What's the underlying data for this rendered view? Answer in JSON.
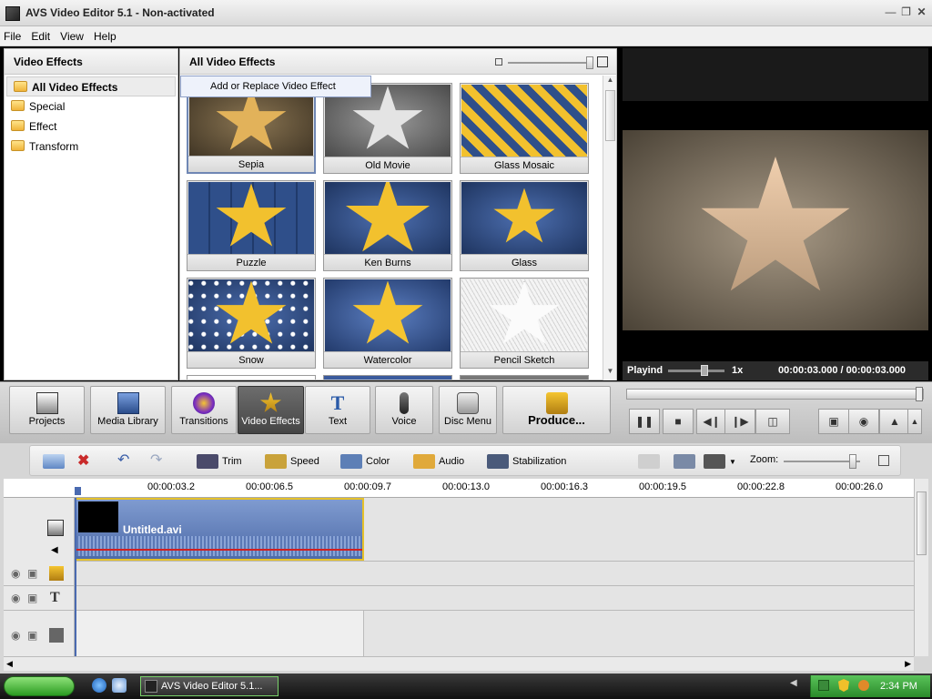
{
  "window": {
    "title": "AVS Video Editor 5.1 - Non-activated"
  },
  "menu": [
    "File",
    "Edit",
    "View",
    "Help"
  ],
  "left_panel": {
    "header": "Video Effects",
    "categories": [
      "All Video Effects",
      "Special",
      "Effect",
      "Transform"
    ]
  },
  "center_panel": {
    "header": "All Video Effects",
    "tooltip": "Add or Replace Video Effect",
    "effects": [
      "Sepia",
      "Old Movie",
      "Glass Mosaic",
      "Puzzle",
      "Ken Burns",
      "Glass",
      "Snow",
      "Watercolor",
      "Pencil Sketch"
    ]
  },
  "preview": {
    "state": "Playind",
    "speed": "1x",
    "time": "00:00:03.000 / 00:00:03.000"
  },
  "main_toolbar": {
    "projects": "Projects",
    "media_library": "Media Library",
    "transitions": "Transitions",
    "video_effects": "Video Effects",
    "text": "Text",
    "voice": "Voice",
    "disc_menu": "Disc Menu",
    "produce": "Produce..."
  },
  "timeline_toolbar": {
    "trim": "Trim",
    "speed": "Speed",
    "color": "Color",
    "audio": "Audio",
    "stabilization": "Stabilization",
    "zoom": "Zoom:"
  },
  "ruler": [
    "00:00:03.2",
    "00:00:06.5",
    "00:00:09.7",
    "00:00:13.0",
    "00:00:16.3",
    "00:00:19.5",
    "00:00:22.8",
    "00:00:26.0"
  ],
  "clip": {
    "name": "Untitled.avi"
  },
  "taskbar": {
    "item": "AVS Video Editor 5.1...",
    "clock": "2:34 PM"
  },
  "colors": {
    "accent": "#6f87b4",
    "dark_panel": "#2b2b2b",
    "star_gold": "#f2c12e"
  }
}
